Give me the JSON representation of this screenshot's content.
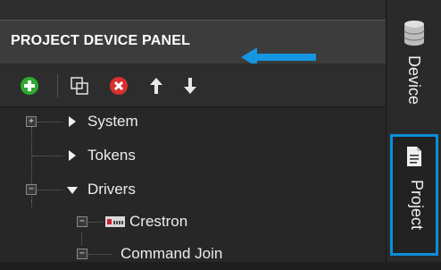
{
  "panel": {
    "title": "PROJECT DEVICE PANEL"
  },
  "toolbar": {
    "buttons": [
      {
        "name": "add",
        "icon": "plus-circle-icon",
        "color": "#2fa82f"
      },
      {
        "name": "duplicate",
        "icon": "duplicate-icon",
        "color": "#d8d8d8"
      },
      {
        "name": "remove",
        "icon": "x-circle-icon",
        "color": "#d83030"
      },
      {
        "name": "move-up",
        "icon": "arrow-up-icon",
        "color": "#e8e8e8"
      },
      {
        "name": "move-down",
        "icon": "arrow-down-icon",
        "color": "#e8e8e8"
      }
    ]
  },
  "tree": {
    "items": [
      {
        "label": "System",
        "expand": "+",
        "caret": "right"
      },
      {
        "label": "Tokens",
        "expand": "",
        "caret": "right"
      },
      {
        "label": "Drivers",
        "expand": "−",
        "caret": "down"
      },
      {
        "label": "Crestron",
        "expand": "−",
        "icon": "crestron-device-icon"
      },
      {
        "label": "Command Join",
        "expand": "−"
      }
    ]
  },
  "side_tabs": {
    "device": "Device",
    "project": "Project"
  },
  "colors": {
    "highlight": "#0a8fd8",
    "panel_bg": "#2d2d2d",
    "header_bg": "#3c3c3c"
  }
}
